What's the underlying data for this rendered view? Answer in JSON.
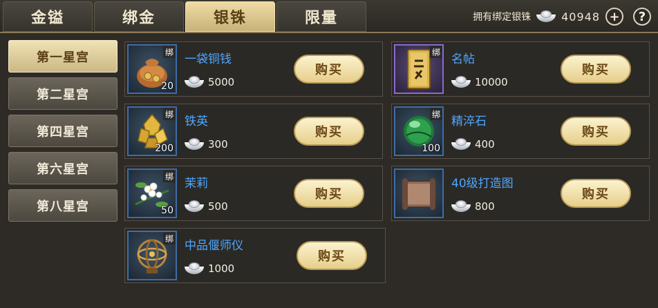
{
  "tabs": [
    {
      "label": "金镒",
      "active": false
    },
    {
      "label": "绑金",
      "active": false
    },
    {
      "label": "银铢",
      "active": true
    },
    {
      "label": "限量",
      "active": false
    }
  ],
  "currency": {
    "label": "拥有绑定银铢",
    "amount": "40948",
    "icon": "silver-ingot-icon",
    "add_label": "+",
    "help_label": "?"
  },
  "sidebar": {
    "items": [
      {
        "label": "第一星宫",
        "active": true
      },
      {
        "label": "第二星宫",
        "active": false
      },
      {
        "label": "第四星宫",
        "active": false
      },
      {
        "label": "第六星宫",
        "active": false
      },
      {
        "label": "第八星宫",
        "active": false
      }
    ]
  },
  "shop": {
    "buy_label": "购买",
    "bind_badge": "绑",
    "items": [
      {
        "name": "一袋铜钱",
        "price": "5000",
        "quantity": "20",
        "icon": "coin-bag-icon"
      },
      {
        "name": "名帖",
        "price": "10000",
        "quantity": "",
        "icon": "name-card-icon"
      },
      {
        "name": "铁英",
        "price": "300",
        "quantity": "200",
        "icon": "iron-ore-icon"
      },
      {
        "name": "精淬石",
        "price": "400",
        "quantity": "100",
        "icon": "green-orb-icon"
      },
      {
        "name": "茉莉",
        "price": "500",
        "quantity": "50",
        "icon": "jasmine-flower-icon"
      },
      {
        "name": "40级打造图",
        "price": "800",
        "quantity": "",
        "icon": "scroll-blueprint-icon"
      },
      {
        "name": "中品偃师仪",
        "price": "1000",
        "quantity": "",
        "icon": "armillary-sphere-icon"
      }
    ]
  },
  "colors": {
    "item_name": "#4da6ff",
    "active_tab": "#efdca4",
    "icon_border_blue": "#3e6da8",
    "icon_border_purple": "#8a6ad1"
  }
}
